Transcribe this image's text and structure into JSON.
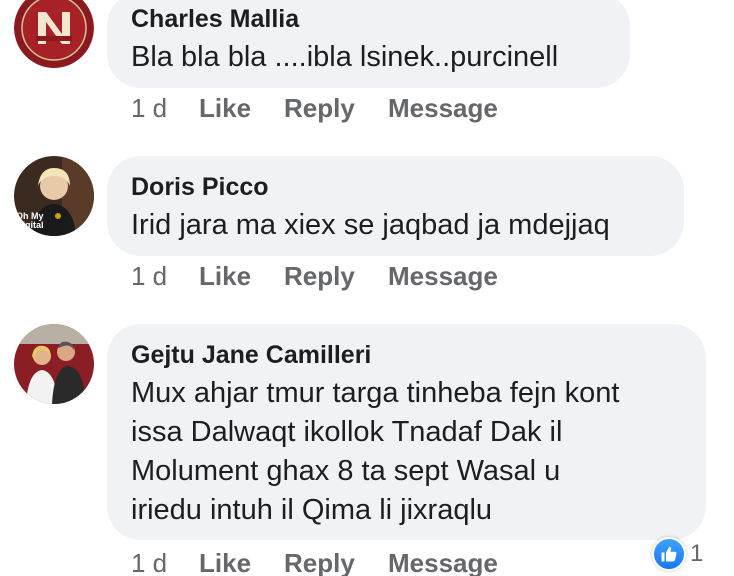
{
  "comments": [
    {
      "author": "Charles Mallia",
      "text": "Bla bla bla ....ibla lsinek..purcinell",
      "avatar_icon": "brand-logo-avatar",
      "time": "1 d",
      "like_label": "Like",
      "reply_label": "Reply",
      "message_label": "Message"
    },
    {
      "author": "Doris Picco",
      "text": "Irid jara ma xiex se jaqbad ja mdejjaq",
      "avatar_icon": "person-avatar",
      "avatar_overlay_text": "Oh My Digital",
      "time": "1 d",
      "like_label": "Like",
      "reply_label": "Reply",
      "message_label": "Message"
    },
    {
      "author": "Gejtu Jane Camilleri",
      "text": "Mux ahjar tmur targa tinheba fejn kont\nissa Dalwaqt ikollok Tnadaf Dak il\nMolument ghax 8 ta sept Wasal u\niriedu intuh il Qima li jixraqlu",
      "avatar_icon": "couple-avatar",
      "time": "1 d",
      "like_label": "Like",
      "reply_label": "Reply",
      "message_label": "Message"
    }
  ],
  "reaction": {
    "icon": "thumbs-up-icon",
    "count": "1",
    "color": "#1877f2"
  }
}
